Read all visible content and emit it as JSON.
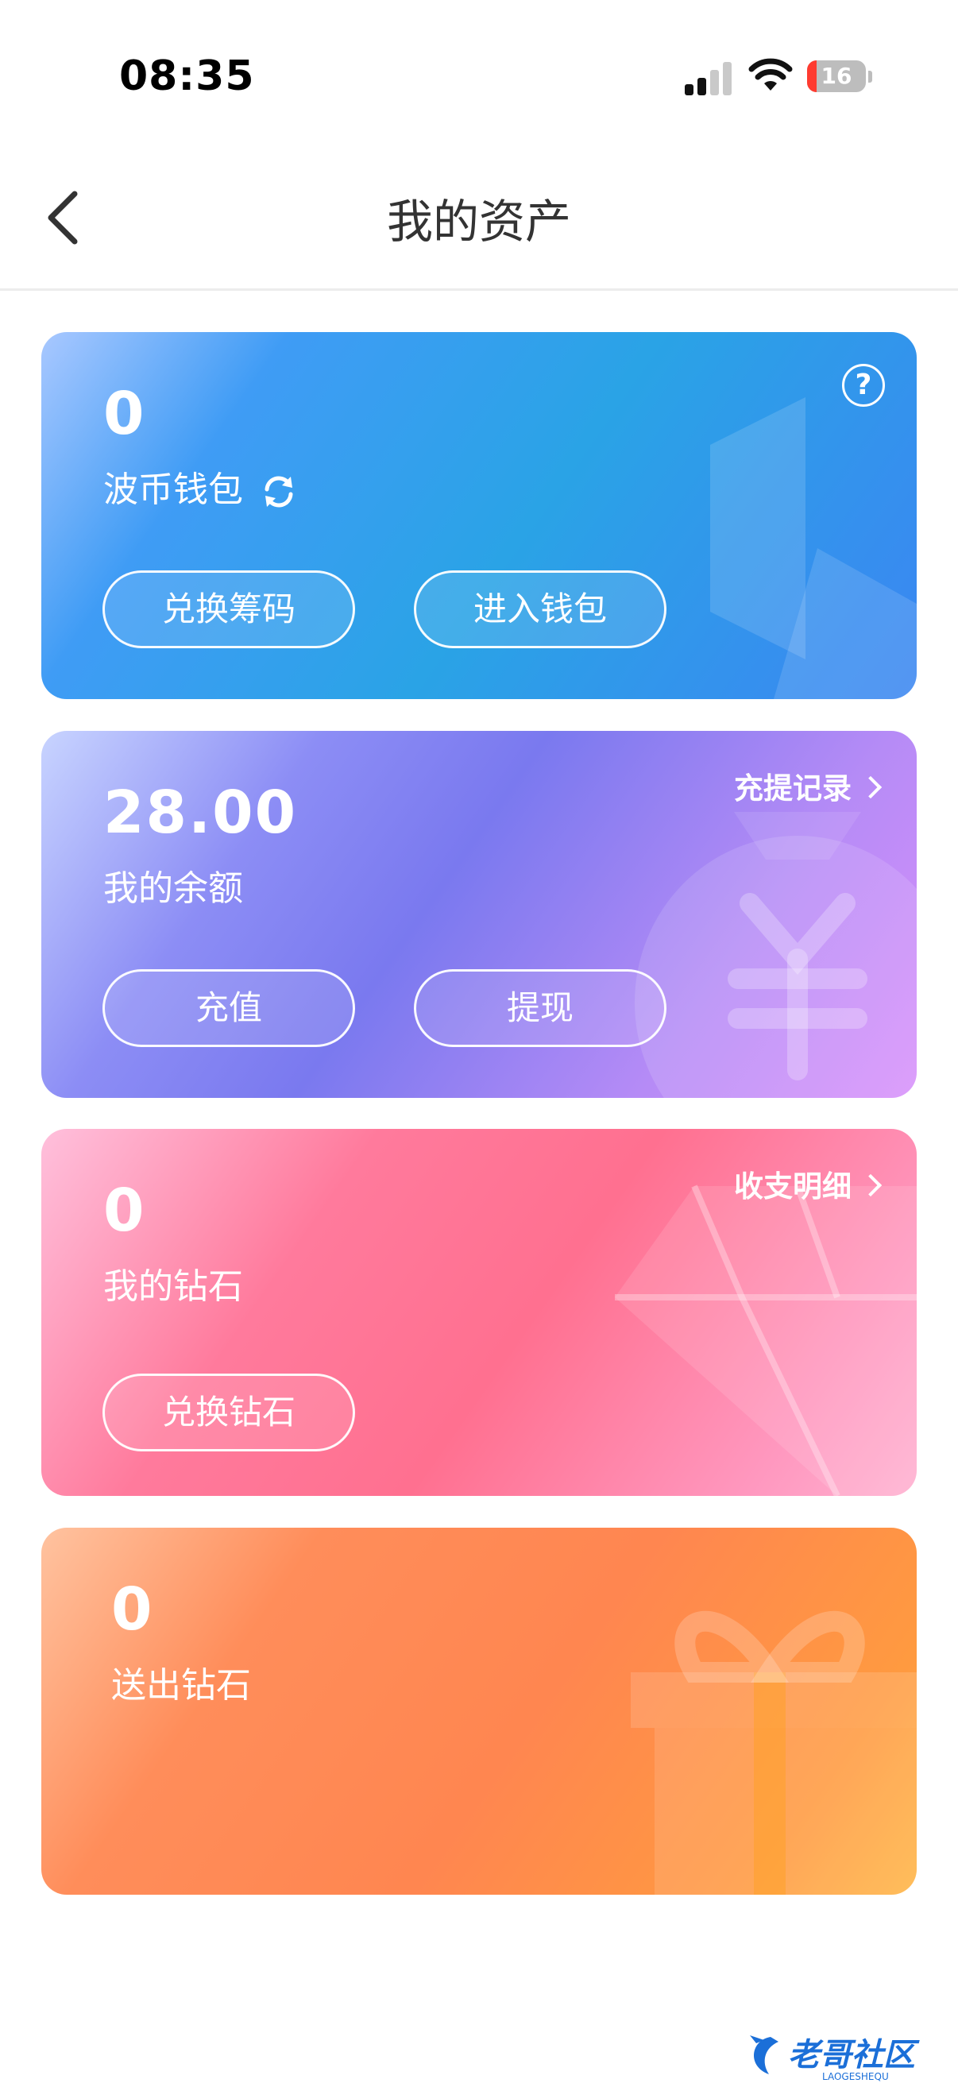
{
  "status_bar": {
    "time": "08:35",
    "battery_level": "16",
    "battery_color": "#ff3b30"
  },
  "nav": {
    "title": "我的资产",
    "back_icon": "chevron-left-icon"
  },
  "wallet_card": {
    "value": "0",
    "label": "波币钱包",
    "refresh_icon": "refresh-icon",
    "help_icon": "?",
    "buttons": [
      {
        "label": "兑换筹码"
      },
      {
        "label": "进入钱包"
      }
    ]
  },
  "balance_card": {
    "value": "28.00",
    "label": "我的余额",
    "link": "充提记录",
    "buttons": [
      {
        "label": "充值"
      },
      {
        "label": "提现"
      }
    ]
  },
  "diamond_card": {
    "value": "0",
    "label": "我的钻石",
    "link": "收支明细",
    "buttons": [
      {
        "label": "兑换钻石"
      }
    ]
  },
  "sent_card": {
    "value": "0",
    "label": "送出钻石"
  },
  "watermark": {
    "text": "老哥社区",
    "subtext": "LAOGESHEQU"
  }
}
